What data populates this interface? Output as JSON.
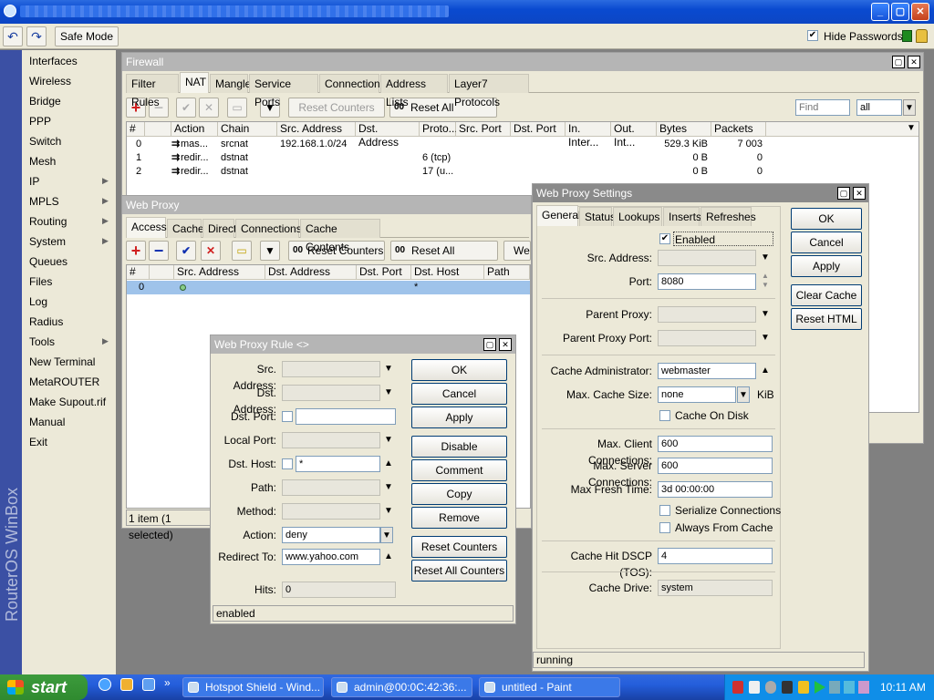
{
  "window": {
    "minimize": "_",
    "maximize": "▢",
    "close": "✕"
  },
  "toolbar": {
    "undo": "↶",
    "redo": "↷",
    "safe_mode": "Safe Mode",
    "hide_passwords": "Hide Passwords"
  },
  "sidebar": {
    "brand": "RouterOS WinBox",
    "items": [
      {
        "label": "Interfaces"
      },
      {
        "label": "Wireless"
      },
      {
        "label": "Bridge"
      },
      {
        "label": "PPP"
      },
      {
        "label": "Switch"
      },
      {
        "label": "Mesh"
      },
      {
        "label": "IP"
      },
      {
        "label": "MPLS"
      },
      {
        "label": "Routing"
      },
      {
        "label": "System"
      },
      {
        "label": "Queues"
      },
      {
        "label": "Files"
      },
      {
        "label": "Log"
      },
      {
        "label": "Radius"
      },
      {
        "label": "Tools"
      },
      {
        "label": "New Terminal"
      },
      {
        "label": "MetaROUTER"
      },
      {
        "label": "Make Supout.rif"
      },
      {
        "label": "Manual"
      },
      {
        "label": "Exit"
      }
    ]
  },
  "firewall": {
    "title": "Firewall",
    "tabs": [
      "Filter Rules",
      "NAT",
      "Mangle",
      "Service Ports",
      "Connections",
      "Address Lists",
      "Layer7 Protocols"
    ],
    "reset_counters": "Reset Counters",
    "reset_all_counters": "Reset All Counters",
    "find_placeholder": "Find",
    "filter_value": "all",
    "oo": "00",
    "columns": [
      "#",
      "",
      "Action",
      "Chain",
      "Src. Address",
      "Dst. Address",
      "Proto...",
      "Src. Port",
      "Dst. Port",
      "In. Inter...",
      "Out. Int...",
      "Bytes",
      "Packets"
    ],
    "rows": [
      {
        "num": "0",
        "action": "mas...",
        "chain": "srcnat",
        "src": "192.168.1.0/24",
        "proto": "",
        "bytes": "529.3 KiB",
        "packets": "7 003"
      },
      {
        "num": "1",
        "action": "redir...",
        "chain": "dstnat",
        "src": "",
        "proto": "6 (tcp)",
        "bytes": "0 B",
        "packets": "0"
      },
      {
        "num": "2",
        "action": "redir...",
        "chain": "dstnat",
        "src": "",
        "proto": "17 (u...",
        "bytes": "0 B",
        "packets": "0"
      }
    ]
  },
  "webproxy": {
    "title": "Web Proxy",
    "tabs": [
      "Access",
      "Cache",
      "Direct",
      "Connections",
      "Cache Contents"
    ],
    "reset_counters": "Reset Counters",
    "reset_all_counters": "Reset All Counters",
    "extra_button": "We",
    "oo": "00",
    "columns": [
      "#",
      "",
      "Src. Address",
      "Dst. Address",
      "Dst. Port",
      "Dst. Host",
      "Path"
    ],
    "row": {
      "num": "0",
      "dst_host": "*"
    },
    "status": "1 item (1 selected)"
  },
  "rule": {
    "title": "Web Proxy Rule <>",
    "fields": {
      "src_address": "Src. Address:",
      "dst_address": "Dst. Address:",
      "dst_port": "Dst. Port:",
      "local_port": "Local Port:",
      "dst_host": "Dst. Host:",
      "dst_host_value": "*",
      "path": "Path:",
      "method": "Method:",
      "action": "Action:",
      "action_value": "deny",
      "redirect_to": "Redirect To:",
      "redirect_value": "www.yahoo.com",
      "hits": "Hits:",
      "hits_value": "0"
    },
    "buttons": {
      "ok": "OK",
      "cancel": "Cancel",
      "apply": "Apply",
      "disable": "Disable",
      "comment": "Comment",
      "copy": "Copy",
      "remove": "Remove",
      "reset_counters": "Reset Counters",
      "reset_all_counters": "Reset All Counters"
    },
    "status": "enabled"
  },
  "settings": {
    "title": "Web Proxy Settings",
    "tabs": [
      "General",
      "Status",
      "Lookups",
      "Inserts",
      "Refreshes"
    ],
    "enabled": "Enabled",
    "labels": {
      "src_address": "Src. Address:",
      "port": "Port:",
      "parent_proxy": "Parent Proxy:",
      "parent_proxy_port": "Parent Proxy Port:",
      "cache_admin": "Cache Administrator:",
      "max_cache_size": "Max. Cache Size:",
      "cache_on_disk": "Cache On Disk",
      "max_client": "Max. Client Connections:",
      "max_server": "Max. Server Connections:",
      "max_fresh": "Max Fresh Time:",
      "serialize": "Serialize Connections",
      "always_cache": "Always From Cache",
      "dscp": "Cache Hit DSCP (TOS):",
      "cache_drive": "Cache Drive:"
    },
    "values": {
      "port": "8080",
      "cache_admin": "webmaster",
      "max_cache_size": "none",
      "kib": "KiB",
      "max_client": "600",
      "max_server": "600",
      "max_fresh": "3d 00:00:00",
      "dscp": "4",
      "cache_drive": "system"
    },
    "buttons": {
      "ok": "OK",
      "cancel": "Cancel",
      "apply": "Apply",
      "clear_cache": "Clear Cache",
      "reset_html": "Reset HTML"
    },
    "status": "running"
  },
  "taskbar": {
    "start": "start",
    "tasks": [
      {
        "label": "Hotspot Shield - Wind..."
      },
      {
        "label": "admin@00:0C:42:36:..."
      },
      {
        "label": "untitled - Paint"
      }
    ],
    "clock": "10:11 AM"
  }
}
